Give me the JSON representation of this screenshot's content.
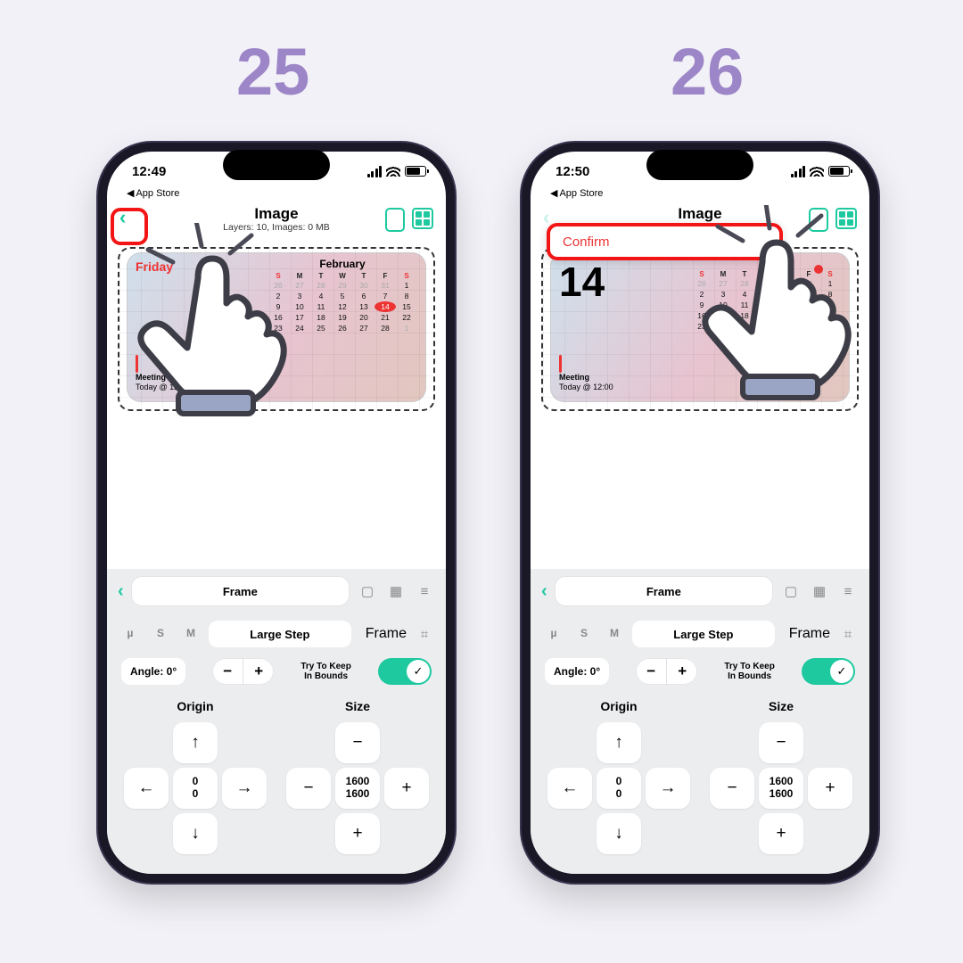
{
  "steps": {
    "left": "25",
    "right": "26"
  },
  "status": {
    "time_left": "12:49",
    "time_right": "12:50",
    "back": "App Store"
  },
  "header": {
    "title": "Image",
    "subtitle": "Layers: 10, Images: 0 MB"
  },
  "confirm_label": "Confirm",
  "calendar": {
    "day_name": "Friday",
    "day_num": "14",
    "month": "February",
    "event_title": "Meeting",
    "event_time": "Today @ 12:00",
    "dow": [
      "S",
      "M",
      "T",
      "W",
      "T",
      "F",
      "S"
    ],
    "weeks": [
      [
        "26",
        "27",
        "28",
        "29",
        "30",
        "31",
        "1"
      ],
      [
        "2",
        "3",
        "4",
        "5",
        "6",
        "7",
        "8"
      ],
      [
        "9",
        "10",
        "11",
        "12",
        "13",
        "14",
        "15"
      ],
      [
        "16",
        "17",
        "18",
        "19",
        "20",
        "21",
        "22"
      ],
      [
        "23",
        "24",
        "25",
        "26",
        "27",
        "28",
        "1"
      ]
    ]
  },
  "panel": {
    "tab_frame": "Frame",
    "step_u": "µ",
    "step_s": "S",
    "step_m": "M",
    "step_label": "Large Step",
    "frame_btn": "Frame",
    "angle": "Angle: 0°",
    "keep1": "Try To Keep",
    "keep2": "In Bounds"
  },
  "origin": {
    "label": "Origin",
    "x": "0",
    "y": "0"
  },
  "size": {
    "label": "Size",
    "w": "1600",
    "h": "1600"
  },
  "glyph": {
    "chev_left": "‹",
    "chev_right": "›",
    "up": "↑",
    "down": "↓",
    "left": "←",
    "right": "→",
    "minus": "−",
    "plus": "+",
    "check": "✓"
  }
}
